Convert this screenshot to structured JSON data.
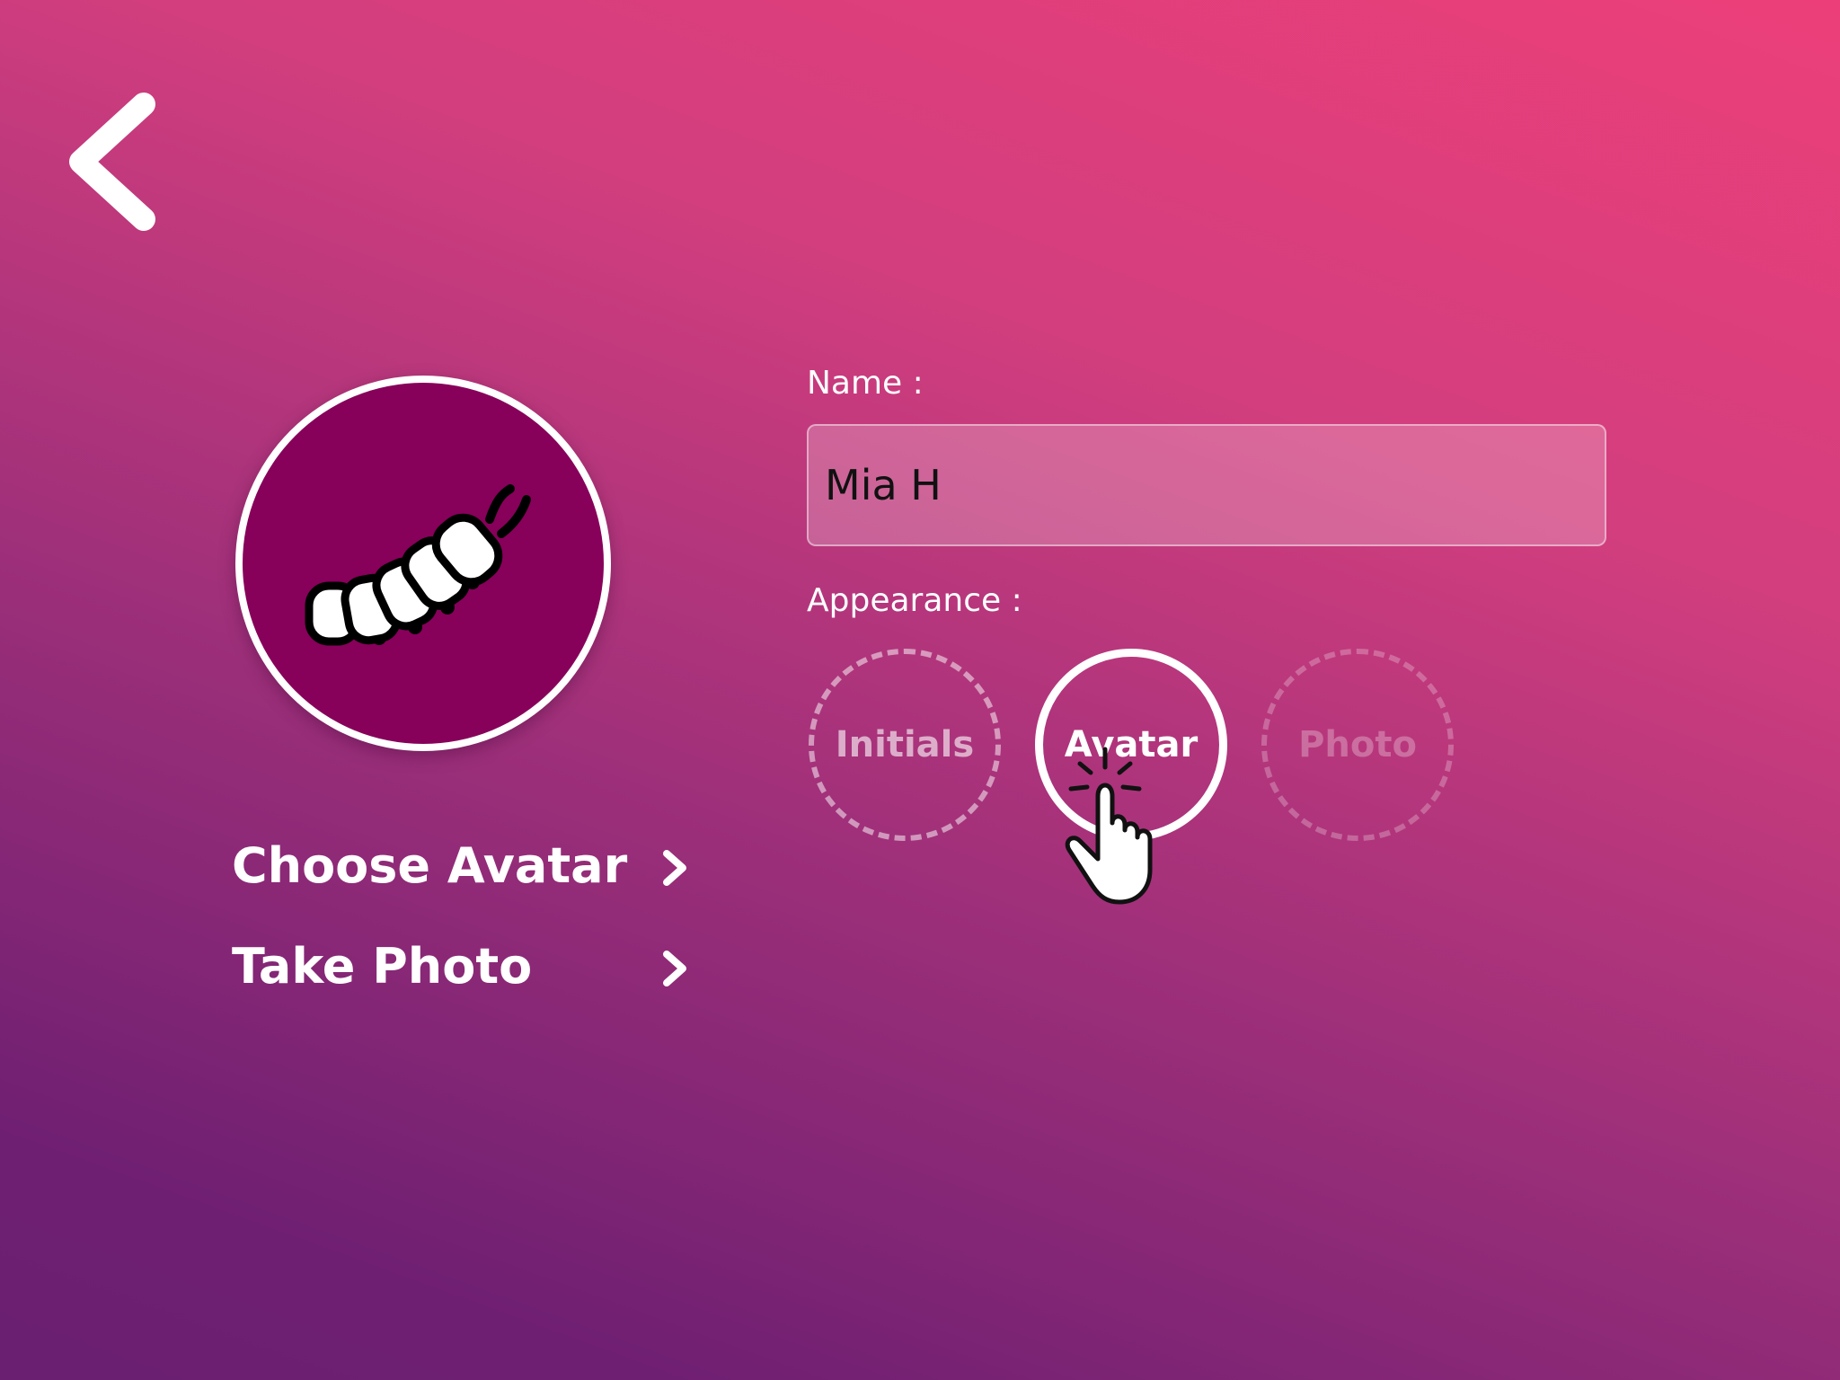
{
  "navigation": {
    "back_icon": "chevron-left-icon"
  },
  "profile": {
    "avatar_icon": "caterpillar-icon",
    "avatar_background": "#87005a",
    "menu": [
      {
        "label": "Choose Avatar",
        "icon": "chevron-right-icon"
      },
      {
        "label": "Take Photo",
        "icon": "chevron-right-icon"
      }
    ]
  },
  "form": {
    "name_label": "Name :",
    "name_value": "Mia H",
    "appearance_label": "Appearance :",
    "appearance_options": [
      {
        "label": "Initials",
        "state": "unselected"
      },
      {
        "label": "Avatar",
        "state": "selected"
      },
      {
        "label": "Photo",
        "state": "disabled"
      }
    ]
  },
  "hint": {
    "icon": "tap-hand-icon"
  }
}
